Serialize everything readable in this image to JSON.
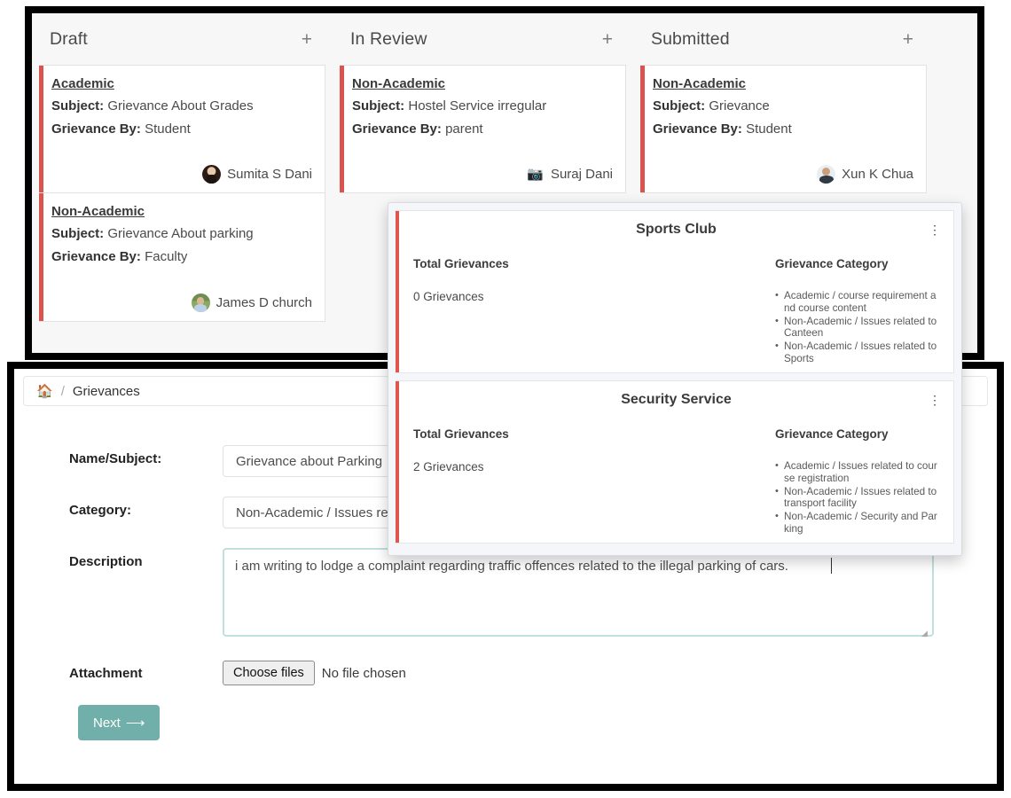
{
  "kanban": {
    "columns": [
      {
        "title": "Draft",
        "add_label": "+",
        "cards": [
          {
            "type": "Academic",
            "subject_label": "Subject:",
            "subject": "Grievance About Grades",
            "by_label": "Grievance By:",
            "by": "Student",
            "person": "Sumita S Dani",
            "avatar": "woman-avatar"
          },
          {
            "type": "Non-Academic",
            "subject_label": "Subject:",
            "subject": "Grievance About parking",
            "by_label": "Grievance By:",
            "by": "Faculty",
            "person": "James D church",
            "avatar": "man-outdoor-avatar"
          }
        ]
      },
      {
        "title": "In Review",
        "add_label": "+",
        "cards": [
          {
            "type": "Non-Academic",
            "subject_label": "Subject:",
            "subject": "Hostel Service irregular",
            "by_label": "Grievance By:",
            "by": "parent",
            "person": "Suraj Dani",
            "avatar": "camera-placeholder-avatar"
          }
        ]
      },
      {
        "title": "Submitted",
        "add_label": "+",
        "cards": [
          {
            "type": "Non-Academic",
            "subject_label": "Subject:",
            "subject": "Grievance",
            "by_label": "Grievance By:",
            "by": "Student",
            "person": "Xun K Chua",
            "avatar": "man-avatar"
          }
        ]
      }
    ]
  },
  "popup": {
    "panels": [
      {
        "title": "Sports Club",
        "kebab": "⋮",
        "total_label": "Total Grievances",
        "total_value": "0 Grievances",
        "category_label": "Grievance Category",
        "categories": [
          "Academic / course requirement and course content",
          "Non-Academic / Issues related to Canteen",
          "Non-Academic / Issues related to Sports"
        ]
      },
      {
        "title": "Security Service",
        "kebab": "⋮",
        "total_label": "Total Grievances",
        "total_value": "2 Grievances",
        "category_label": "Grievance Category",
        "categories": [
          "Academic / Issues related to course registration",
          "Non-Academic / Issues related to transport facility",
          "Non-Academic / Security and Parking"
        ]
      }
    ]
  },
  "form": {
    "breadcrumb": {
      "home_icon": "home-icon",
      "separator": "/",
      "current": "Grievances"
    },
    "fields": {
      "name_label": "Name/Subject:",
      "name_value": "Grievance about Parking",
      "category_label": "Category:",
      "category_value": "Non-Academic / Issues related to Security and Parking",
      "description_label": "Description",
      "description_value": "i am writing to lodge a complaint regarding traffic offences related to the illegal parking of cars.",
      "attachment_label": "Attachment",
      "choose_files_label": "Choose files",
      "no_file_label": "No file chosen"
    },
    "next_label": "Next",
    "next_arrow": "⟶"
  },
  "colors": {
    "card_accent": "#d9534f",
    "popup_accent": "#e0564f",
    "next_button": "#71b0aa",
    "textarea_focus": "#bfe0dd"
  }
}
